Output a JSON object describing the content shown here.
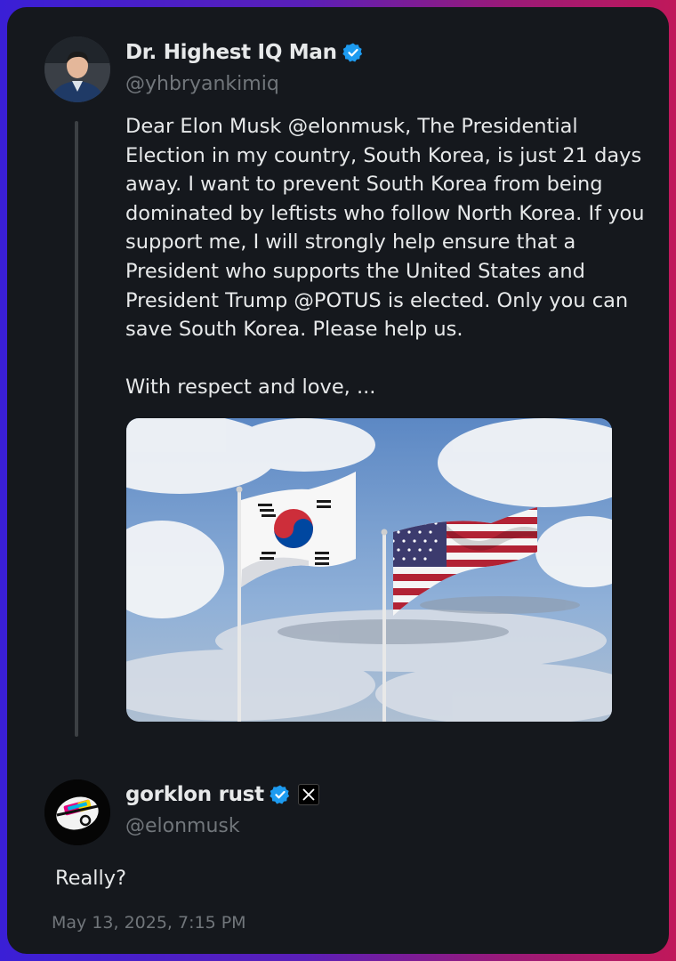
{
  "tweet": {
    "author_name": "Dr. Highest IQ Man",
    "handle": "@yhbryankimiq",
    "body": "Dear Elon Musk @elonmusk, The Presidential Election in my country, South Korea, is just 21 days away. I want to prevent South Korea from being dominated by leftists who follow North Korea. If you support me, I will strongly help ensure that a President who supports the United States and President Trump @POTUS is elected. Only you can save South Korea. Please help us.\n\nWith respect and love, ..."
  },
  "reply": {
    "author_name": "gorklon rust",
    "handle": "@elonmusk",
    "body": "Really?",
    "timestamp": "May 13, 2025, 7:15 PM"
  },
  "colors": {
    "card_bg": "#15181d",
    "text_primary": "#e7e9ea",
    "text_secondary": "#71767b",
    "verified_blue": "#1d9bf0"
  },
  "icons": {
    "verified": "verified-badge-icon",
    "x_affiliation": "x-logo-icon",
    "media": "flags-photo"
  }
}
